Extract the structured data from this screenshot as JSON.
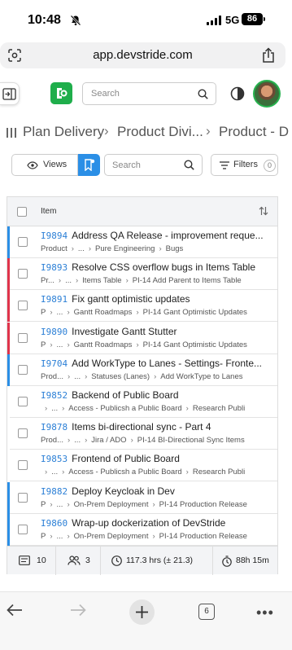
{
  "status_bar": {
    "time": "10:48",
    "network": "5G",
    "battery": "86"
  },
  "browser": {
    "url": "app.devstride.com"
  },
  "header": {
    "search_placeholder": "Search"
  },
  "breadcrumb": [
    "Plan Delivery",
    "Product Divi...",
    "Product - D"
  ],
  "toolbar": {
    "views_label": "Views",
    "search_placeholder": "Search",
    "filters_label": "Filters",
    "filters_count": "0"
  },
  "table": {
    "header": "Item",
    "rows": [
      {
        "id": "I9894",
        "title": "Address QA Release - improvement reque...",
        "path": [
          "Product",
          "...",
          "Pure Engineering",
          "Bugs"
        ],
        "color": "#2b8fe6"
      },
      {
        "id": "I9893",
        "title": "Resolve CSS overflow bugs in Items Table",
        "path": [
          "Pr...",
          "...",
          "Items Table",
          "PI-14 Add Parent to Items Table"
        ],
        "color": "#e0344b"
      },
      {
        "id": "I9891",
        "title": "Fix gantt optimistic updates",
        "path": [
          "P",
          "...",
          "Gantt Roadmaps",
          "PI-14 Gant Optimistic Updates"
        ],
        "color": "#e0344b"
      },
      {
        "id": "I9890",
        "title": "Investigate Gantt Stutter",
        "path": [
          "P",
          "...",
          "Gantt Roadmaps",
          "PI-14 Gant Optimistic Updates"
        ],
        "color": "#e0344b"
      },
      {
        "id": "I9704",
        "title": "Add WorkType to Lanes - Settings- Fronte...",
        "path": [
          "Prod...",
          "...",
          "Statuses (Lanes)",
          "Add WorkType to Lanes"
        ],
        "color": "#2b8fe6"
      },
      {
        "id": "I9852",
        "title": "Backend of Public Board",
        "path": [
          "",
          "...",
          "Access - Publicsh a Public Board",
          "Research Publi"
        ],
        "color": "#ffffff"
      },
      {
        "id": "I9878",
        "title": "Items bi-directional sync - Part 4",
        "path": [
          "Prod...",
          "...",
          "Jira / ADO",
          "PI-14 BI-Directional Sync Items"
        ],
        "color": "#ffffff"
      },
      {
        "id": "I9853",
        "title": "Frontend of Public Board",
        "path": [
          "",
          "...",
          "Access - Publicsh a Public Board",
          "Research Publi"
        ],
        "color": "#ffffff"
      },
      {
        "id": "I9882",
        "title": "Deploy Keycloak in Dev",
        "path": [
          "P",
          "...",
          "On-Prem Deployment",
          "PI-14 Production Release"
        ],
        "color": "#2b8fe6"
      },
      {
        "id": "I9860",
        "title": "Wrap-up dockerization of DevStride",
        "path": [
          "P",
          "...",
          "On-Prem Deployment",
          "PI-14 Production Release"
        ],
        "color": "#2b8fe6"
      }
    ],
    "footer": {
      "items": "10",
      "people": "3",
      "hours": "117.3 hrs (± 21.3)",
      "time": "88h 15m"
    }
  },
  "bottom_bar": {
    "tabs_count": "6"
  }
}
